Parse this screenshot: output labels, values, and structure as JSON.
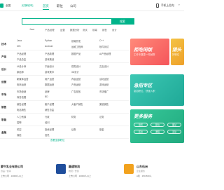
{
  "nav": {
    "city": "全国",
    "city_switch": "[切换城市]",
    "items": [
      "首页",
      "职位",
      "公司"
    ],
    "app_download": "手机上拉勾"
  },
  "search": {
    "placeholder": "",
    "button": "搜索",
    "hot": [
      "Java",
      "产品经理",
      "运营",
      "数据分析",
      "测试",
      "前端",
      "销售",
      "设计"
    ]
  },
  "categories": [
    {
      "title": "技术",
      "links": [
        "Java",
        "Python",
        "前端开发",
        "C++",
        "iOS",
        "Android",
        "运维工程师",
        "软件测试"
      ]
    },
    {
      "title": "产品",
      "links": [
        "产品经理",
        "产品助理",
        "数据产品",
        "AI产品经理",
        "产品总监",
        "游戏策划"
      ]
    },
    {
      "title": "设计",
      "links": [
        "UI设计师",
        "平面设计",
        "视觉设计",
        "交互设计",
        "原画师",
        "游戏美术",
        "3D设计"
      ]
    },
    {
      "title": "运营",
      "links": [
        "新媒体运营",
        "用户运营",
        "内容运营",
        "活动运营",
        "电商运营",
        "数据运营",
        "产品运营",
        "游戏运营"
      ]
    },
    {
      "title": "市场",
      "links": [
        "市场营销",
        "品牌",
        "广告投放",
        "市场推广",
        "商务拓展",
        "BD"
      ]
    },
    {
      "title": "销售",
      "links": [
        "销售经理",
        "客户经理",
        "大客户销售",
        "渠道销售",
        "电话销售",
        "销售总监"
      ]
    },
    {
      "title": "职能",
      "links": [
        "人力资源",
        "行政",
        "财务",
        "法务",
        "招聘",
        "培训"
      ]
    },
    {
      "title": "金融",
      "links": [
        "风控",
        "投资经理",
        "证券",
        "基金",
        "保险",
        "信托"
      ]
    }
  ],
  "categories_footer": "查看全部职位",
  "banners": {
    "b1": {
      "title": "拒吃闲饭",
      "sub": "工作卡路里一吃就胖"
    },
    "b2": {
      "title": "猎头",
      "sub": "好职位"
    },
    "b3": {
      "title": "急招专区",
      "sub": "急招职位，快速入职"
    },
    "b4": {
      "title": "更多服务",
      "pills": [
        "简历",
        "职位",
        "面试",
        "薪资",
        "课程",
        "活动"
      ]
    }
  },
  "companies": [
    {
      "name": "蒙牛乳业有限公司",
      "desc": "食品 / 快消",
      "info": "上市公司 · 10000人以上"
    },
    {
      "name": "圆通物流",
      "desc": "物流 / 仓储",
      "info": "上市公司 · 10000人以上"
    },
    {
      "name": "山东伍洲",
      "desc": "企业服务",
      "info": "A轮 · 150-500人"
    }
  ],
  "colors": {
    "brand": "#00b38a",
    "banner_red": "#f5555a",
    "banner_yellow": "#eea02a",
    "banner_teal": "#1fa997",
    "banner_green": "#21aa7f"
  }
}
